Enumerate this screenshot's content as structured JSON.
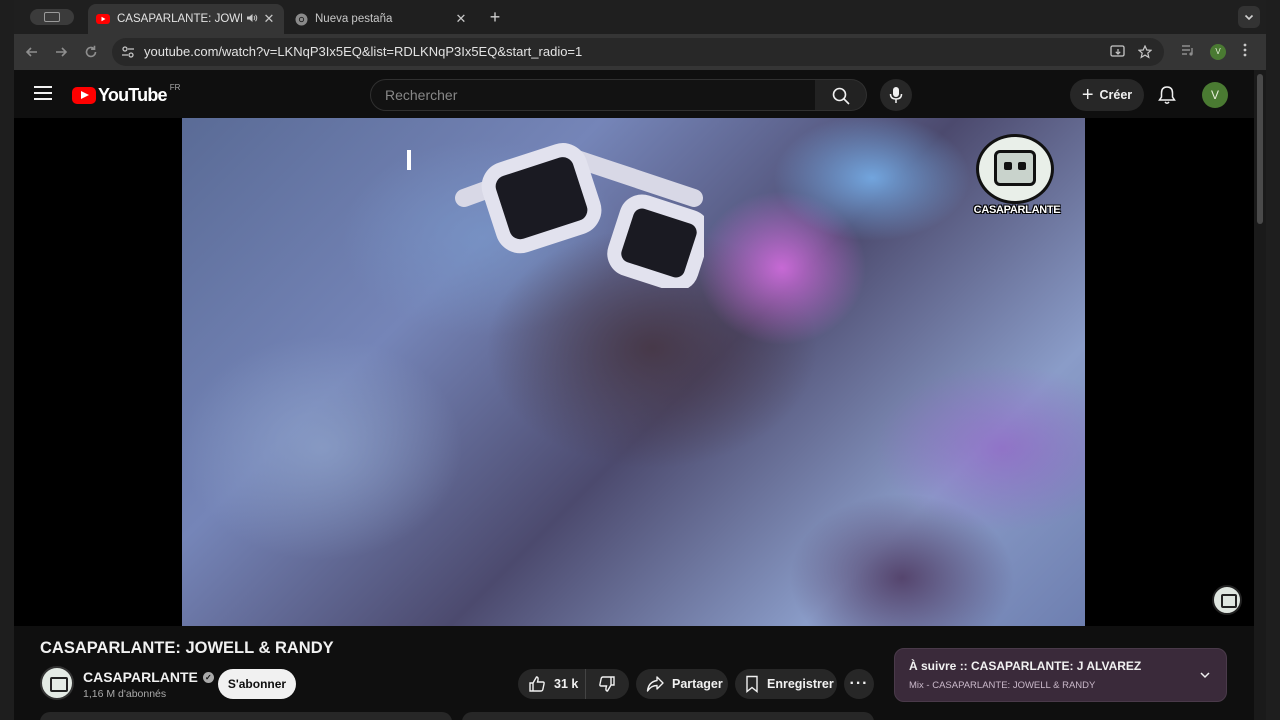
{
  "browser": {
    "tabs": [
      {
        "title": "CASAPARLANTE: JOWELL & RANDY",
        "active": true,
        "audio": true
      },
      {
        "title": "Nueva pestaña",
        "active": false
      }
    ],
    "url": "youtube.com/watch?v=LKNqP3Ix5EQ&list=RDLKNqP3Ix5EQ&start_radio=1",
    "profile_initial": "V"
  },
  "masthead": {
    "logo_text": "YouTube",
    "country_code": "FR",
    "search_placeholder": "Rechercher",
    "create_label": "Créer",
    "avatar_initial": "V"
  },
  "video": {
    "overlay_logo_text": "CASAPARLANTE",
    "title": "CASAPARLANTE: JOWELL & RANDY"
  },
  "channel": {
    "name": "CASAPARLANTE",
    "verified_mark": "✓",
    "subscribers": "1,16 M d'abonnés",
    "subscribe_label": "S'abonner"
  },
  "actions": {
    "likes": "31 k",
    "share_label": "Partager",
    "save_label": "Enregistrer",
    "more_label": "···"
  },
  "up_next": {
    "line1": "À suivre :: CASAPARLANTE: J ALVAREZ",
    "line2": "Mix - CASAPARLANTE: JOWELL & RANDY"
  },
  "colors": {
    "brand_red": "#ff0000",
    "background": "#0f0f0f",
    "avatar_green": "#4a7a32",
    "up_next_bg": "#3a2a3a"
  }
}
